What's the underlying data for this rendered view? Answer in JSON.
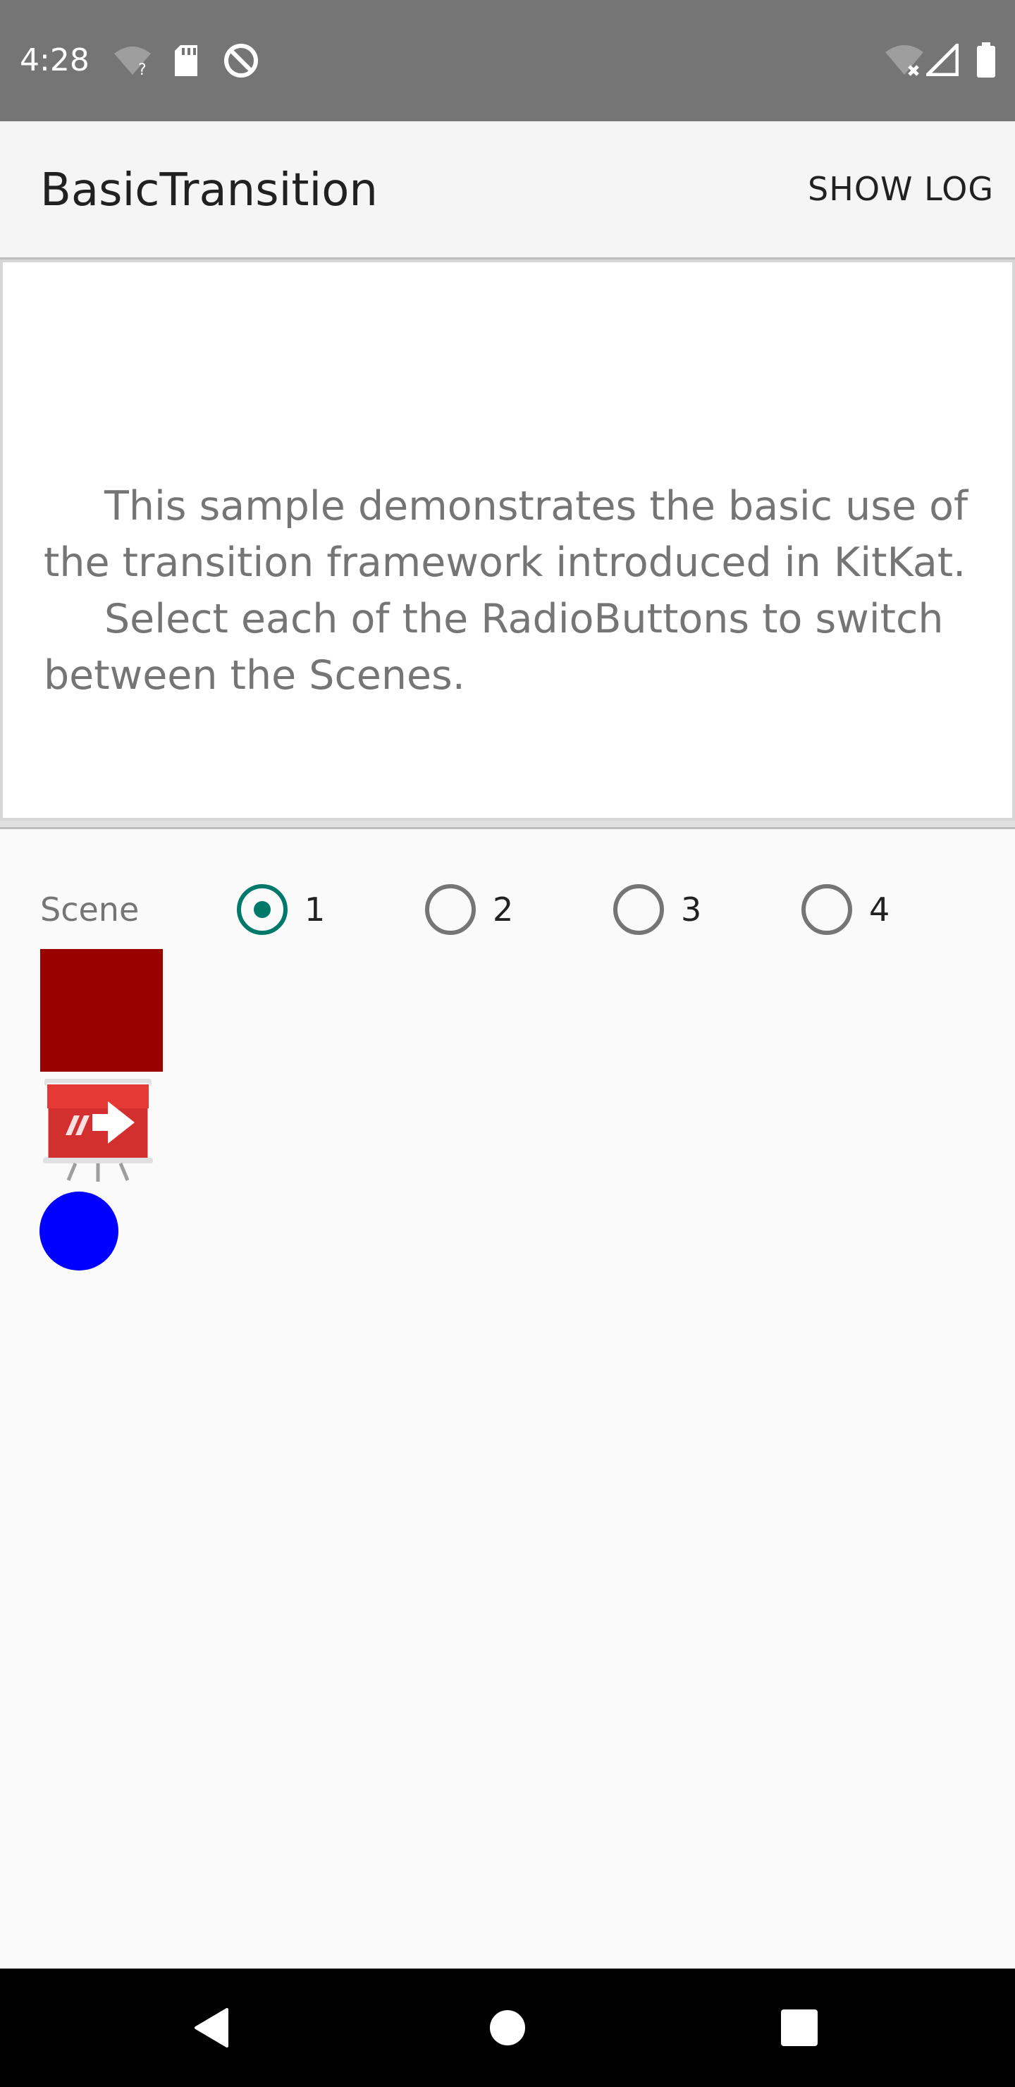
{
  "status_bar": {
    "time": "4:28",
    "icons": [
      "wifi-unknown-icon",
      "sd-card-icon",
      "do-not-disturb-icon",
      "wifi-off-icon",
      "signal-icon",
      "battery-icon"
    ]
  },
  "app_bar": {
    "title": "BasicTransition",
    "action_label": "SHOW LOG"
  },
  "intro": {
    "paragraphs": [
      "This sample demonstrates the basic use of the transition framework introduced in KitKat.",
      "Select each of the RadioButtons to switch between the Scenes."
    ]
  },
  "scene_selector": {
    "label": "Scene",
    "options": [
      "1",
      "2",
      "3",
      "4"
    ],
    "selected": "1"
  },
  "scene_content": {
    "square_color": "#990000",
    "circle_color": "#0000ff",
    "icon": "presentation-arrow-icon"
  },
  "colors": {
    "accent": "#00796b",
    "status_bar": "#757575"
  },
  "nav_bar": {
    "buttons": [
      "back-icon",
      "home-icon",
      "recents-icon"
    ]
  }
}
